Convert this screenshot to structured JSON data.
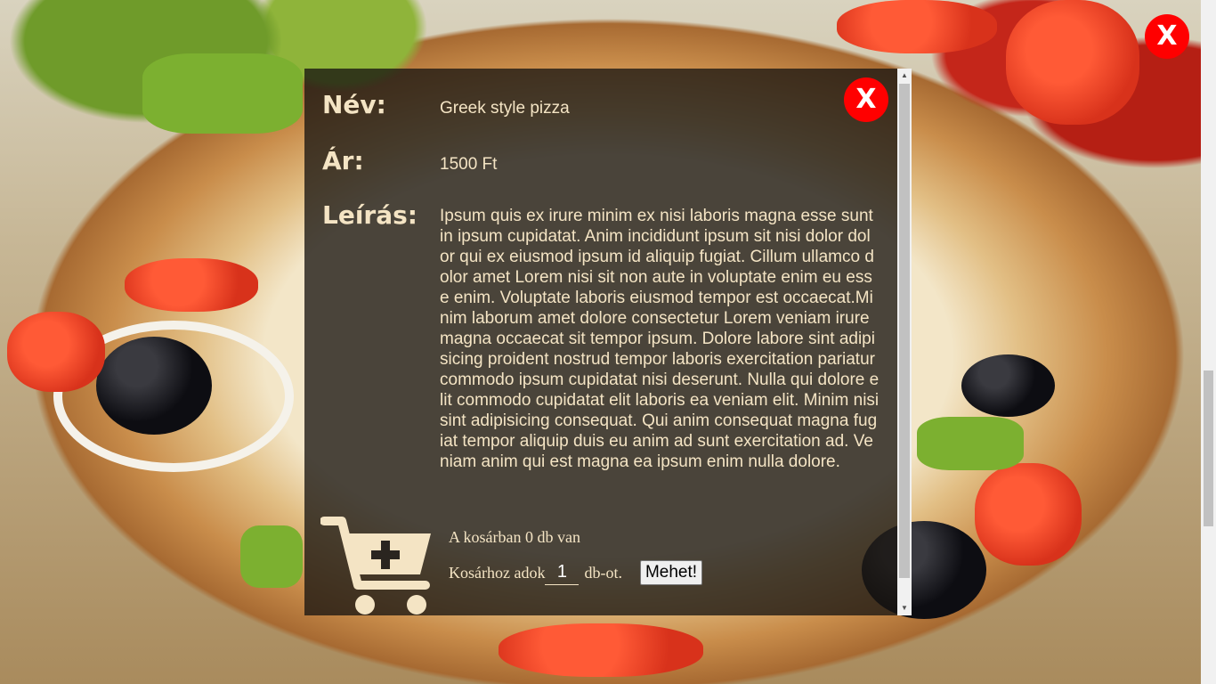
{
  "page": {
    "close_label": "X"
  },
  "product": {
    "name_label": "Név:",
    "name": "Greek style pizza",
    "price_label": "Ár:",
    "price": "1500 Ft",
    "desc_label": "Leírás:",
    "description": "Ipsum quis ex irure minim ex nisi laboris magna esse sunt in ipsum cupidatat. Anim incididunt ipsum sit nisi dolor dolor qui ex eiusmod ipsum id aliquip fugiat. Cillum ullamco dolor amet Lorem nisi sit non aute in voluptate enim eu esse enim. Voluptate laboris eiusmod tempor est occaecat.Minim laborum amet dolore consectetur Lorem veniam irure magna occaecat sit tempor ipsum. Dolore labore sint adipisicing proident nostrud tempor laboris exercitation pariatur commodo ipsum cupidatat nisi deserunt. Nulla qui dolore elit commodo cupidatat elit laboris ea veniam elit. Minim nisi sint adipisicing consequat. Qui anim consequat magna fugiat tempor aliquip duis eu anim ad sunt exercitation ad. Veniam anim qui est magna ea ipsum enim nulla dolore.",
    "close_label": "X"
  },
  "cart": {
    "icon": "cart-plus-icon",
    "status_text": "A kosárban 0 db van",
    "add_prefix": "Kosárhoz adok",
    "quantity": "1",
    "add_suffix": "db-ot.",
    "go_label": "Mehet!"
  },
  "colors": {
    "close_button": "#ff0000",
    "text_accent": "#f4e4c4"
  }
}
